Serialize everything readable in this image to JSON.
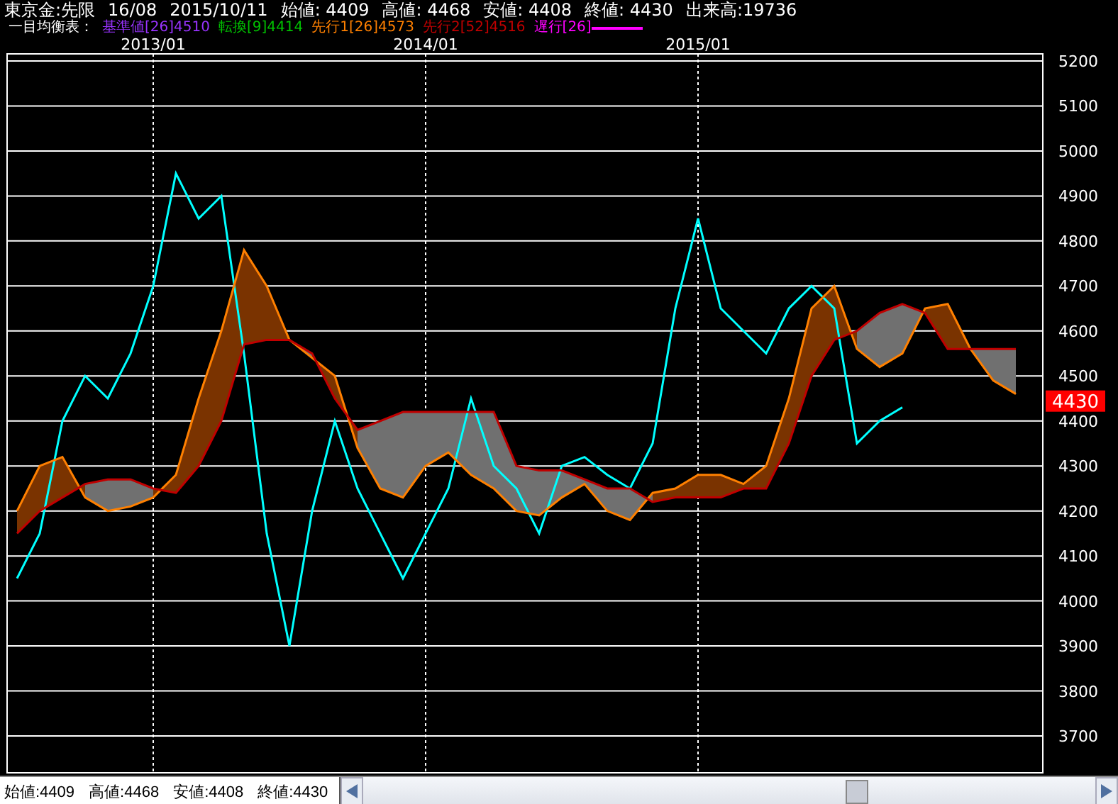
{
  "header": {
    "fields": [
      "東京金:先限",
      "16/08",
      "2015/10/11",
      "始値: 4409",
      "高値: 4468",
      "安値: 4408",
      "終値: 4430",
      "出来高:19736"
    ]
  },
  "legend": {
    "label": "一目均衡表：",
    "items": [
      {
        "text": "基準値[26]4510",
        "color": "#9933ff"
      },
      {
        "text": "転換[9]4414",
        "color": "#00c000"
      },
      {
        "text": "先行1[26]4573",
        "color": "#ff8000"
      },
      {
        "text": "先行2[52]4516",
        "color": "#c00000"
      },
      {
        "text": "遅行[26]",
        "color": "#ff00ff"
      }
    ]
  },
  "chart": {
    "last_price": "4430",
    "chart_data": {
      "type": "line",
      "grid": true,
      "categories": [
        null,
        null,
        null,
        null,
        null,
        null,
        "2013/01",
        null,
        null,
        null,
        null,
        null,
        null,
        null,
        null,
        null,
        null,
        null,
        "2014/01",
        null,
        null,
        null,
        null,
        null,
        null,
        null,
        null,
        null,
        null,
        null,
        "2015/01",
        null,
        null,
        null,
        null,
        null,
        null,
        null,
        null,
        null,
        null,
        null,
        null,
        null,
        null
      ],
      "series": [
        {
          "color": "#00ffff",
          "values": [
            4050,
            4150,
            4400,
            4500,
            4450,
            4550,
            4700,
            4950,
            4850,
            4900,
            4550,
            4150,
            3900,
            4200,
            4400,
            4250,
            4150,
            4050,
            4150,
            4250,
            4450,
            4300,
            4250,
            4150,
            4300,
            4320,
            4280,
            4250,
            4350,
            4650,
            4850,
            4650,
            4600,
            4550,
            4650,
            4700,
            4650,
            4350,
            4400,
            4430,
            null,
            null,
            null,
            null,
            null
          ]
        },
        {
          "color": "#ff8000",
          "values": [
            4200,
            4300,
            4320,
            4230,
            4200,
            4210,
            4230,
            4280,
            4450,
            4600,
            4780,
            4700,
            4580,
            4540,
            4500,
            4340,
            4250,
            4230,
            4300,
            4330,
            4280,
            4250,
            4200,
            4190,
            4230,
            4260,
            4200,
            4180,
            4240,
            4250,
            4280,
            4280,
            4260,
            4300,
            4450,
            4650,
            4700,
            4560,
            4520,
            4550,
            4650,
            4660,
            4560,
            4490,
            4460
          ]
        },
        {
          "color": "#c00000",
          "values": [
            4150,
            4200,
            4230,
            4260,
            4270,
            4270,
            4250,
            4240,
            4300,
            4400,
            4570,
            4580,
            4580,
            4550,
            4450,
            4380,
            4400,
            4420,
            4420,
            4420,
            4420,
            4420,
            4300,
            4290,
            4290,
            4270,
            4250,
            4250,
            4220,
            4230,
            4230,
            4230,
            4250,
            4250,
            4350,
            4500,
            4580,
            4600,
            4640,
            4660,
            4640,
            4560,
            4560,
            4560,
            4560
          ]
        }
      ],
      "yticks": [
        3700,
        3800,
        3900,
        4000,
        4100,
        4200,
        4300,
        4400,
        4500,
        4600,
        4700,
        4800,
        4900,
        5000,
        5100,
        5200
      ],
      "ylim": [
        3700,
        5200
      ]
    }
  },
  "status_bar": {
    "fields": [
      "始値:4409",
      "高値:4468",
      "安値:4408",
      "終値:4430"
    ]
  }
}
